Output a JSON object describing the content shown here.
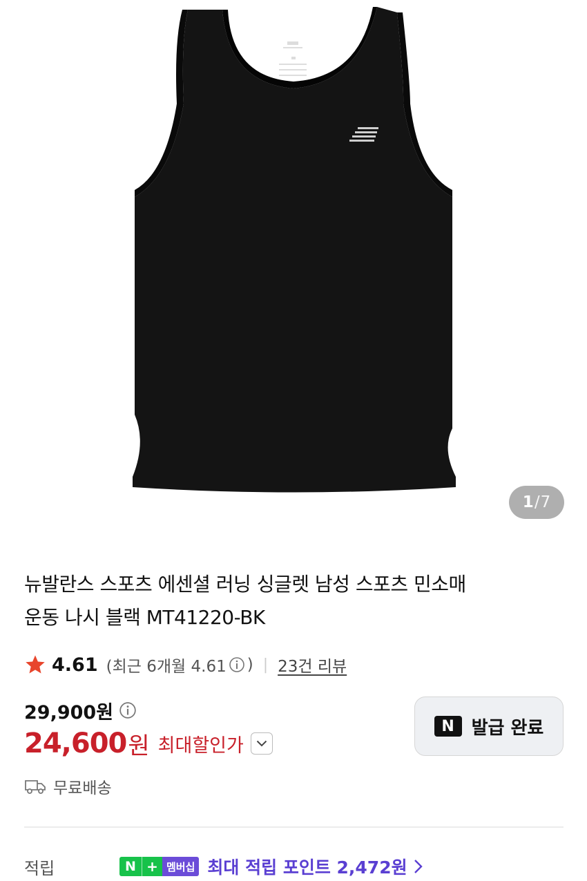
{
  "product": {
    "title_line1": "뉴발란스 스포츠 에센셜 러닝 싱글렛 남성 스포츠 민소매",
    "title_line2": "운동 나시 블랙 MT41220-BK",
    "image_alt": "black running singlet",
    "pager": {
      "current": "1",
      "separator": "/",
      "total": "7"
    }
  },
  "rating": {
    "value": "4.61",
    "recent_prefix": "(최근 6개월 4.61",
    "recent_suffix": ")",
    "divider": "|",
    "review_link": "23건 리뷰"
  },
  "price": {
    "original": "29,900원",
    "sale_amount": "24,600",
    "sale_unit": "원",
    "sale_label": "최대할인가"
  },
  "coupon": {
    "logo": "N",
    "label": "발급 완료"
  },
  "shipping": {
    "text": "무료배송"
  },
  "points": {
    "label": "적립",
    "badge_n": "N",
    "badge_plus": "+",
    "badge_member": "멤버십",
    "text": "최대 적립 포인트 2,472원"
  },
  "colors": {
    "sale": "#c8202a",
    "points": "#5a3fd2",
    "naver_green": "#17c24a",
    "membership_purple": "#6b4cd8",
    "star": "#e8452c"
  },
  "icons": [
    "star-icon",
    "info-icon",
    "chevron-down-icon",
    "truck-icon",
    "chevron-right-icon"
  ]
}
